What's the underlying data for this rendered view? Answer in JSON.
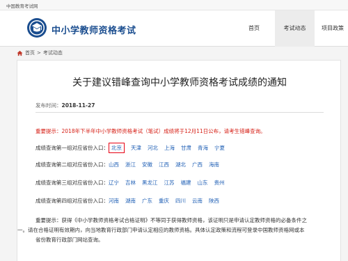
{
  "topbar": {
    "org_link": "中国教育考试网"
  },
  "header": {
    "site_title": "中小学教师资格考试",
    "nav": {
      "home": "首页",
      "news": "考试动态",
      "policy": "项目政策"
    }
  },
  "breadcrumb": {
    "home": "首页",
    "sep": ">",
    "current": "考试动态"
  },
  "article": {
    "title": "关于建议错峰查询中小学教师资格考试成绩的通知",
    "date_label": "发布时间：",
    "date": "2018-11-27",
    "notice": "重要提示：2018年下半年中小学教师资格考试（笔试）成绩将于12月11日公布，请考生错峰查询。",
    "groups": [
      {
        "label": "成绩查询第一组对应省份入口：",
        "provinces": [
          "北京",
          "天津",
          "河北",
          "上海",
          "甘肃",
          "青海",
          "宁夏"
        ]
      },
      {
        "label": "成绩查询第二组对应省份入口：",
        "provinces": [
          "山西",
          "浙江",
          "安徽",
          "江西",
          "湖北",
          "广西",
          "海南"
        ]
      },
      {
        "label": "成绩查询第三组对应省份入口：",
        "provinces": [
          "辽宁",
          "吉林",
          "黑龙江",
          "江苏",
          "福建",
          "山东",
          "贵州"
        ]
      },
      {
        "label": "成绩查询第四组对应省份入口：",
        "provinces": [
          "河南",
          "湖南",
          "广东",
          "重庆",
          "四川",
          "云南",
          "陕西"
        ]
      }
    ],
    "reminder_lines": [
      "重要提示：获得《中小学教师资格考试合格证明》不等同于获得教师资格，该证明只是申请认定教师资格的必备条件之",
      "一。请在合格证明有效期内，向当地教育行政部门申请认定相应的教师资格。具体认定政策和流程可登录中国教师资格网或本",
      "省份教育行政部门网站查询。"
    ]
  },
  "colors": {
    "brand": "#1a4d8f",
    "link": "#1f5fb5",
    "notice": "#d61e14",
    "highlight_box": "#e60012"
  },
  "icons": {
    "logo": "exam-seal-logo",
    "breadcrumb": "home-icon"
  }
}
